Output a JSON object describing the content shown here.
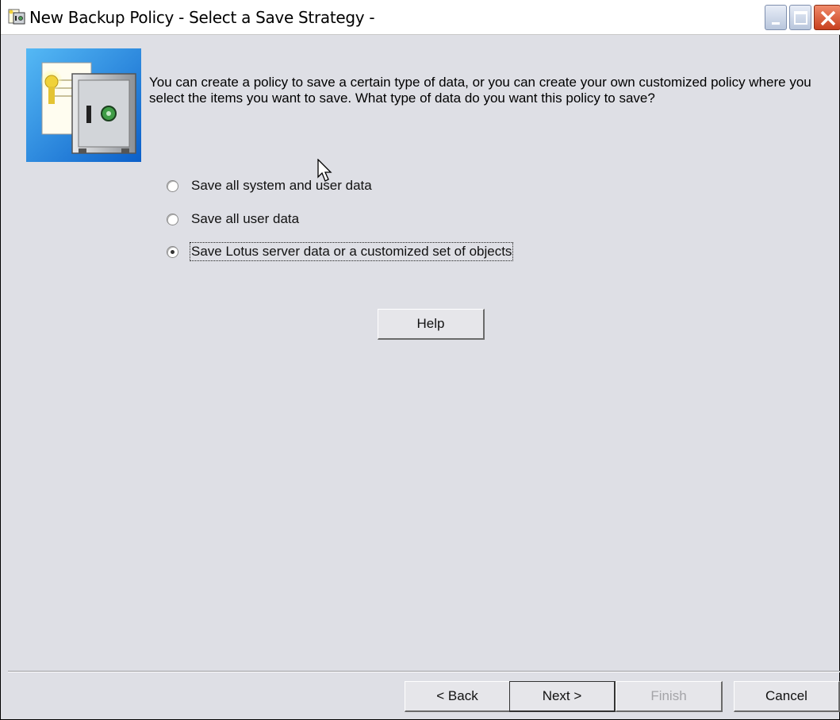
{
  "window": {
    "title": "New Backup Policy - Select a Save Strategy -"
  },
  "intro_text": "You can create a policy to save a certain type of data, or you can create your own customized policy where you select the items you want to save. What type of data do you want this policy to save?",
  "options": [
    {
      "label": "Save all system and user data",
      "checked": false
    },
    {
      "label": "Save all user data",
      "checked": false
    },
    {
      "label": "Save Lotus server data or a customized set of objects",
      "checked": true
    }
  ],
  "buttons": {
    "help": "Help",
    "back": "< Back",
    "next": "Next >",
    "finish": "Finish",
    "cancel": "Cancel"
  },
  "icons": {
    "title": "backup-policy-icon",
    "wizard": "safe-with-certificate-icon"
  },
  "colors": {
    "dialog_background": "#dedfe5",
    "disabled_text": "#a4a4a8",
    "close_button": "#c8401e"
  }
}
